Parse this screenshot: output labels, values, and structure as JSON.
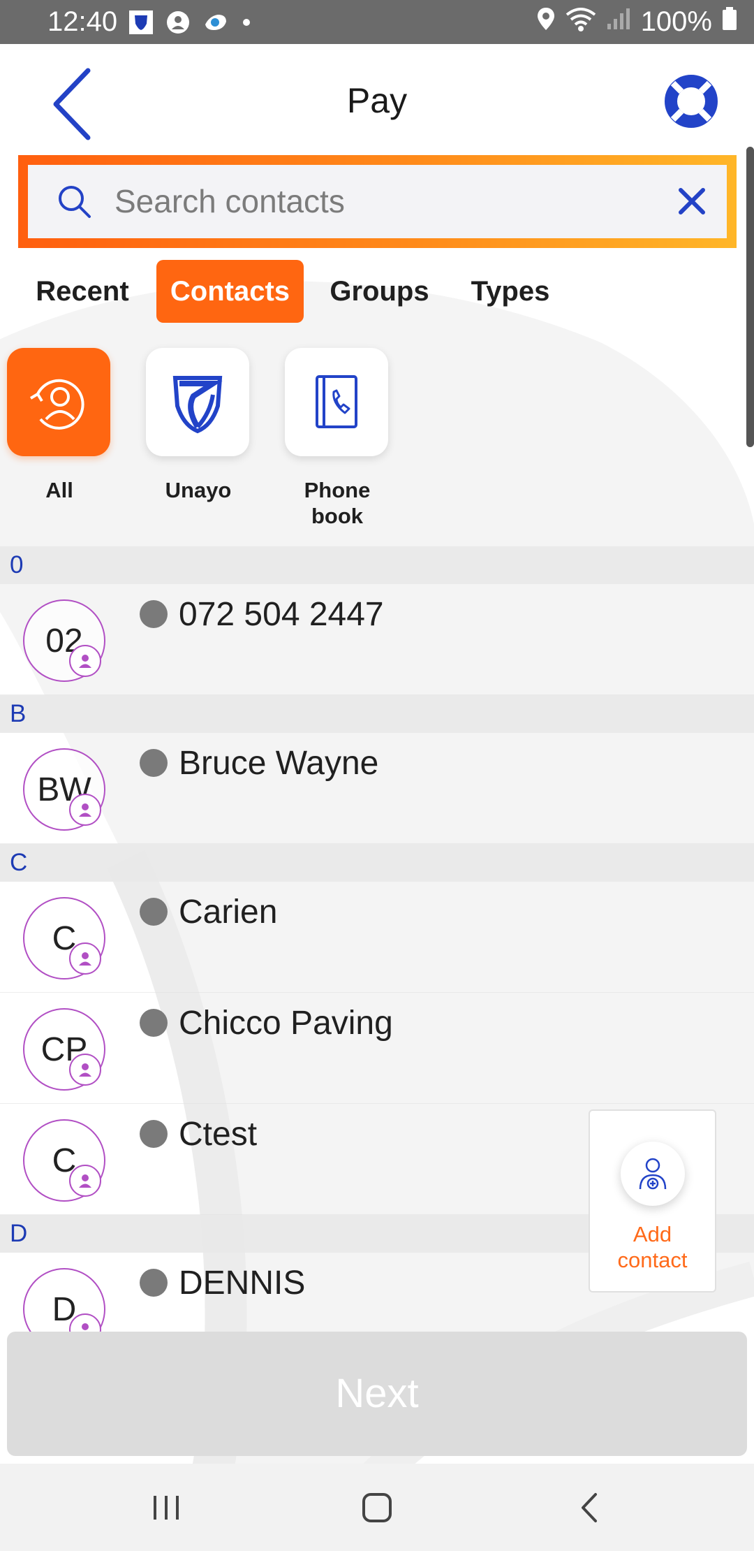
{
  "status_bar": {
    "time": "12:40",
    "battery": "100%"
  },
  "header": {
    "title": "Pay"
  },
  "search": {
    "placeholder": "Search contacts",
    "value": ""
  },
  "tabs": [
    {
      "label": "Recent",
      "active": false
    },
    {
      "label": "Contacts",
      "active": true
    },
    {
      "label": "Groups",
      "active": false
    },
    {
      "label": "Types",
      "active": false
    }
  ],
  "filters": [
    {
      "label": "All",
      "icon": "contact-sync-icon",
      "active": true
    },
    {
      "label": "Unayo",
      "icon": "bank-shield-logo",
      "active": false
    },
    {
      "label": "Phone book",
      "icon": "phone-book-icon",
      "active": false
    }
  ],
  "sections": [
    {
      "letter": "0",
      "contacts": [
        {
          "initials": "02",
          "name": "072 504 2447"
        }
      ]
    },
    {
      "letter": "B",
      "contacts": [
        {
          "initials": "BW",
          "name": "Bruce Wayne"
        }
      ]
    },
    {
      "letter": "C",
      "contacts": [
        {
          "initials": "C",
          "name": "Carien"
        },
        {
          "initials": "CP",
          "name": "Chicco Paving"
        },
        {
          "initials": "C",
          "name": "Ctest"
        }
      ]
    },
    {
      "letter": "D",
      "contacts": [
        {
          "initials": "D",
          "name": "DENNIS"
        }
      ]
    }
  ],
  "add_contact": {
    "label_line1": "Add",
    "label_line2": "contact"
  },
  "next_button": {
    "label": "Next",
    "enabled": false
  },
  "colors": {
    "accent": "#ff6611",
    "brand_blue": "#1d3bb4",
    "avatar_ring": "#b14fc4"
  }
}
